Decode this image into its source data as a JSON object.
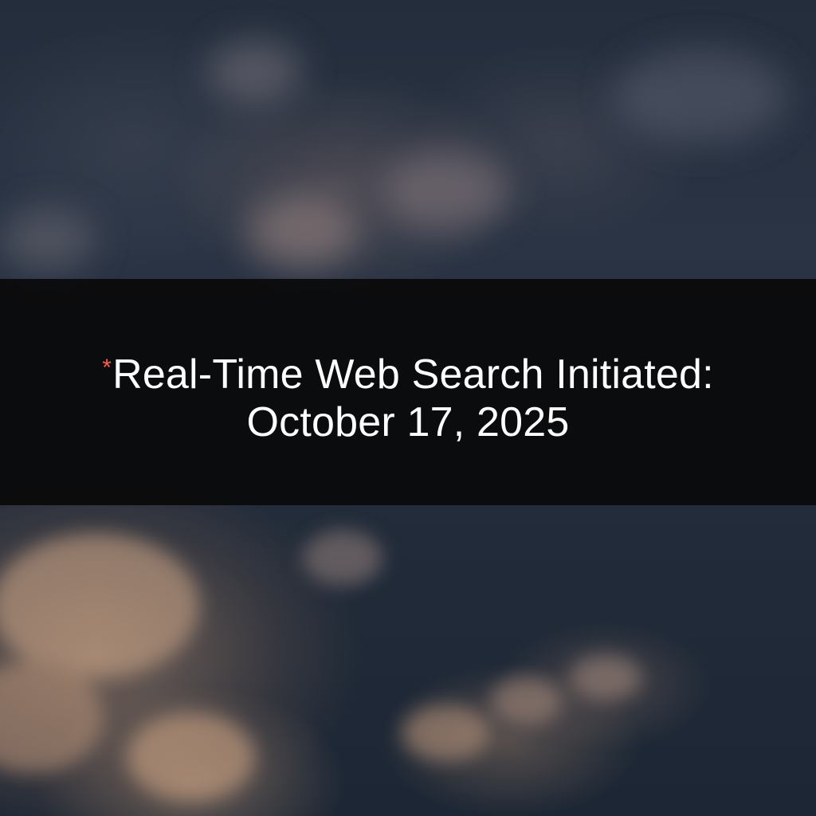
{
  "banner": {
    "marker": "*",
    "line1": "Real-Time Web Search Initiated:",
    "line2": "October 17, 2025"
  },
  "colors": {
    "banner_background": "#0a0a0a",
    "text": "#ffffff",
    "marker": "#ff5a4e"
  }
}
